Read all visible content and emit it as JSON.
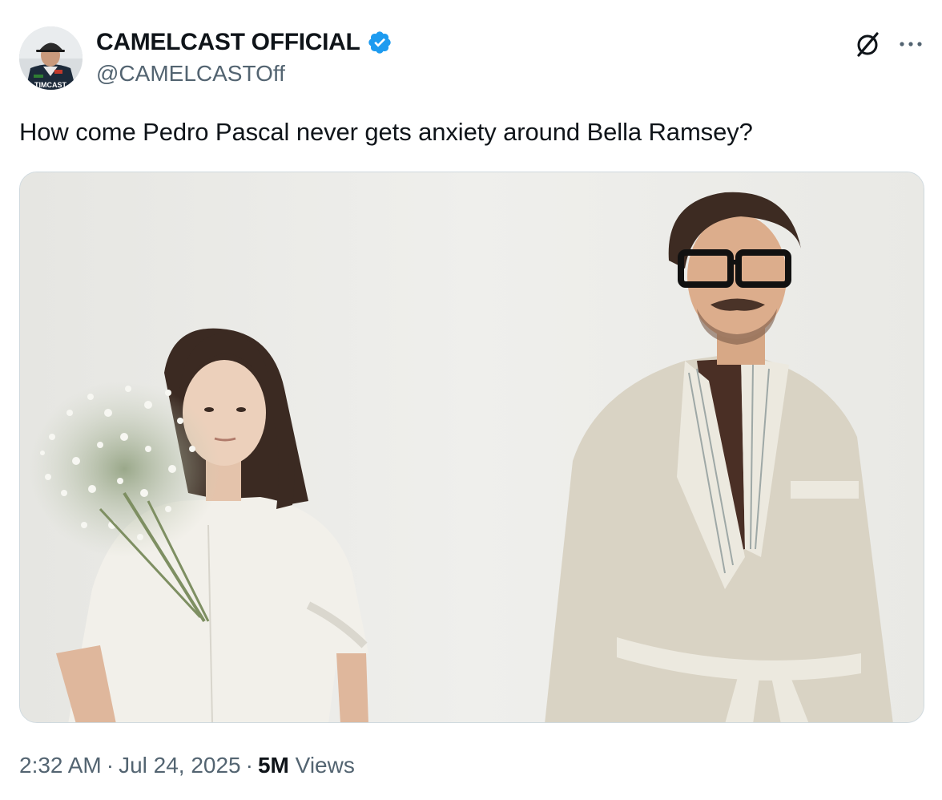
{
  "author": {
    "display_name": "CAMELCAST OFFICIAL",
    "handle": "@CAMELCASTOff",
    "verified": true,
    "avatar_text": "TIMCAST"
  },
  "tweet": {
    "text": "How come Pedro Pascal never gets anxiety around Bella Ramsey?"
  },
  "meta": {
    "time": "2:32 AM",
    "date": "Jul 24, 2025",
    "separator": "·",
    "views_count": "5M",
    "views_label": "Views"
  },
  "icons": {
    "verified": "verified-badge-icon",
    "grok": "grok-icon",
    "more": "more-horizontal-icon"
  },
  "colors": {
    "verified_blue": "#1d9bf0",
    "secondary_text": "#536471",
    "primary_text": "#0f1419",
    "media_border": "#cfd9de"
  }
}
